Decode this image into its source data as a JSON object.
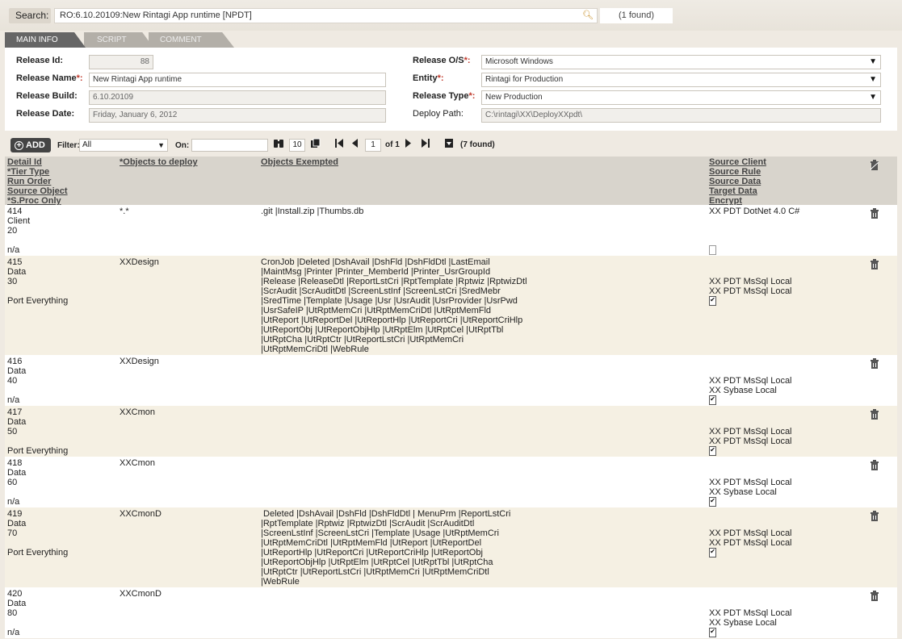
{
  "search": {
    "label": "Search:",
    "value": "RO:6.10.20109:New Rintagi App runtime [NPDT]",
    "found": "(1 found)"
  },
  "tabs": [
    {
      "label": "MAIN INFO"
    },
    {
      "label": "SCRIPT"
    },
    {
      "label": "COMMENT"
    }
  ],
  "form": {
    "release_id": {
      "label": "Release Id:",
      "value": "88"
    },
    "release_name": {
      "label": "Release Name",
      "value": "New Rintagi App runtime"
    },
    "release_build": {
      "label": "Release Build:",
      "value": "6.10.20109"
    },
    "release_date": {
      "label": "Release Date:",
      "value": "Friday, January 6, 2012"
    },
    "release_os": {
      "label": "Release O/S",
      "value": "Microsoft Windows"
    },
    "entity": {
      "label": "Entity",
      "value": "Rintagi for Production"
    },
    "release_type": {
      "label": "Release Type",
      "value": "New Production"
    },
    "deploy_path": {
      "label": "Deploy Path:",
      "value": "C:\\rintagi\\XX\\DeployXXpdt\\"
    },
    "required_mark": "*:"
  },
  "toolbar": {
    "add_label": "ADD",
    "filter_label": "Filter:",
    "filter_value": "All",
    "on_label": "On:",
    "on_value": "",
    "page_size": "10",
    "page_number": "1",
    "page_of": "of 1",
    "found": "(7 found)"
  },
  "grid": {
    "headers": {
      "col1": [
        "Detail Id",
        "*Tier Type",
        "Run Order",
        "Source Object",
        "*S.Proc Only"
      ],
      "col2": [
        "*Objects to deploy"
      ],
      "col3": [
        "Objects Exempted"
      ],
      "col4": [
        "Source Client",
        "Source Rule",
        "Source Data",
        "Target Data",
        "Encrypt"
      ]
    },
    "rows": [
      {
        "id": "414",
        "tier": "Client",
        "run_order": "20",
        "source_object": "",
        "sproc": "n/a",
        "objects": "*.*",
        "exempted": [
          ".git |Install.zip |Thumbs.db"
        ],
        "source_client": "XX PDT DotNet 4.0 C#",
        "source_rule": "",
        "source_data": "",
        "target_data": "",
        "encrypt": false
      },
      {
        "id": "415",
        "tier": "Data",
        "run_order": "30",
        "source_object": "",
        "sproc": "Port Everything",
        "objects": "XXDesign",
        "exempted": [
          "CronJob |Deleted |DshAvail |DshFld |DshFldDtl |LastEmail",
          "|MaintMsg |Printer |Printer_MemberId |Printer_UsrGroupId",
          "|Release |ReleaseDtl |ReportLstCri |RptTemplate |Rptwiz |RptwizDtl",
          "|ScrAudit |ScrAuditDtl |ScreenLstInf |ScreenLstCri |SredMebr",
          "|SredTime |Template |Usage |Usr |UsrAudit |UsrProvider |UsrPwd",
          "|UsrSafeIP |UtRptMemCri |UtRptMemCriDtl |UtRptMemFld",
          "|UtReport |UtReportDel |UtReportHlp |UtReportCri |UtReportCriHlp",
          "|UtReportObj |UtReportObjHlp |UtRptElm |UtRptCel |UtRptTbl",
          "|UtRptCha |UtRptCtr |UtReportLstCri |UtRptMemCri",
          "|UtRptMemCriDtl |WebRule"
        ],
        "source_client": "",
        "source_rule": "",
        "source_data": "XX PDT MsSql Local",
        "target_data": "XX PDT MsSql Local",
        "encrypt": true
      },
      {
        "id": "416",
        "tier": "Data",
        "run_order": "40",
        "source_object": "",
        "sproc": "n/a",
        "objects": "XXDesign",
        "exempted": [],
        "source_client": "",
        "source_rule": "",
        "source_data": "XX PDT MsSql Local",
        "target_data": "XX Sybase Local",
        "encrypt": true
      },
      {
        "id": "417",
        "tier": "Data",
        "run_order": "50",
        "source_object": "",
        "sproc": "Port Everything",
        "objects": "XXCmon",
        "exempted": [],
        "source_client": "",
        "source_rule": "",
        "source_data": "XX PDT MsSql Local",
        "target_data": "XX PDT MsSql Local",
        "encrypt": true
      },
      {
        "id": "418",
        "tier": "Data",
        "run_order": "60",
        "source_object": "",
        "sproc": "n/a",
        "objects": "XXCmon",
        "exempted": [],
        "source_client": "",
        "source_rule": "",
        "source_data": "XX PDT MsSql Local",
        "target_data": "XX Sybase Local",
        "encrypt": true
      },
      {
        "id": "419",
        "tier": "Data",
        "run_order": "70",
        "source_object": "",
        "sproc": "Port Everything",
        "objects": "XXCmonD",
        "exempted": [
          " Deleted |DshAvail |DshFld |DshFldDtl | MenuPrm |ReportLstCri",
          "|RptTemplate |Rptwiz |RptwizDtl |ScrAudit |ScrAuditDtl",
          "|ScreenLstInf |ScreenLstCri |Template |Usage |UtRptMemCri",
          "|UtRptMemCriDtl |UtRptMemFld |UtReport |UtReportDel",
          "|UtReportHlp |UtReportCri |UtReportCriHlp |UtReportObj",
          "|UtReportObjHlp |UtRptElm |UtRptCel |UtRptTbl |UtRptCha",
          "|UtRptCtr |UtReportLstCri |UtRptMemCri |UtRptMemCriDtl",
          "|WebRule"
        ],
        "source_client": "",
        "source_rule": "",
        "source_data": "XX PDT MsSql Local",
        "target_data": "XX PDT MsSql Local",
        "encrypt": true
      },
      {
        "id": "420",
        "tier": "Data",
        "run_order": "80",
        "source_object": "",
        "sproc": "n/a",
        "objects": "XXCmonD",
        "exempted": [],
        "source_client": "",
        "source_rule": "",
        "source_data": "XX PDT MsSql Local",
        "target_data": "XX Sybase Local",
        "encrypt": true
      }
    ]
  }
}
